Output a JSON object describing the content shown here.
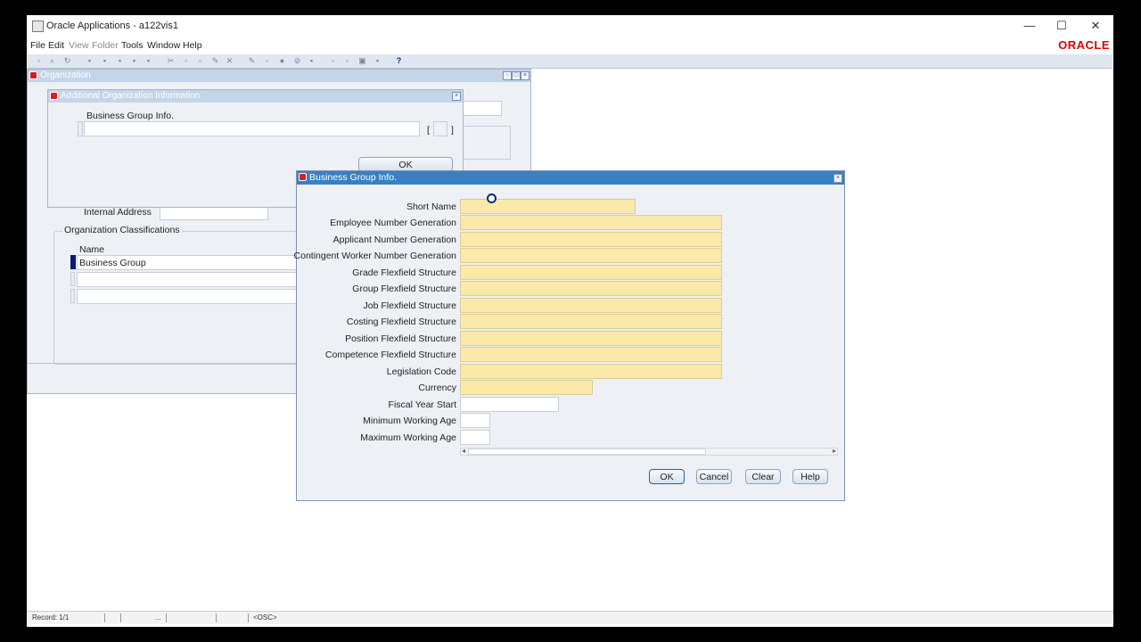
{
  "window": {
    "title": "Oracle Applications - a122vis1",
    "minimize": "—",
    "maximize": "☐",
    "close": "✕"
  },
  "menu": [
    "File",
    "Edit",
    "View",
    "Folder",
    "Tools",
    "Window",
    "Help"
  ],
  "brand": "ORACLE",
  "organization_window": {
    "title": "Organization",
    "internal_address_label": "Internal Address",
    "internal_address_value": "",
    "classifications_label": "Organization Classifications",
    "name_header": "Name",
    "rows": [
      "Business Group",
      "",
      ""
    ]
  },
  "additional_info_window": {
    "title": "Additional Organization Information",
    "field_label": "Business Group Info.",
    "field_value": "",
    "bracket_open": "[",
    "bracket_close": "]",
    "ok_label": "OK"
  },
  "business_group_dialog": {
    "title": "Business Group Info.",
    "fields": [
      {
        "label": "Short Name",
        "value": ""
      },
      {
        "label": "Employee Number Generation",
        "value": ""
      },
      {
        "label": "Applicant Number Generation",
        "value": ""
      },
      {
        "label": "Contingent Worker Number Generation",
        "value": ""
      },
      {
        "label": "Grade Flexfield Structure",
        "value": ""
      },
      {
        "label": "Group Flexfield Structure",
        "value": ""
      },
      {
        "label": "Job Flexfield Structure",
        "value": ""
      },
      {
        "label": "Costing Flexfield Structure",
        "value": ""
      },
      {
        "label": "Position Flexfield Structure",
        "value": ""
      },
      {
        "label": "Competence Flexfield Structure",
        "value": ""
      },
      {
        "label": "Legislation Code",
        "value": ""
      },
      {
        "label": "Currency",
        "value": ""
      },
      {
        "label": "Fiscal Year Start",
        "value": ""
      },
      {
        "label": "Minimum Working Age",
        "value": ""
      },
      {
        "label": "Maximum Working Age",
        "value": ""
      }
    ],
    "buttons": {
      "ok": "OK",
      "cancel": "Cancel",
      "clear": "Clear",
      "help": "Help"
    }
  },
  "status": {
    "record": "Record: 1/1",
    "dots": "...",
    "osc": "<OSC>"
  }
}
